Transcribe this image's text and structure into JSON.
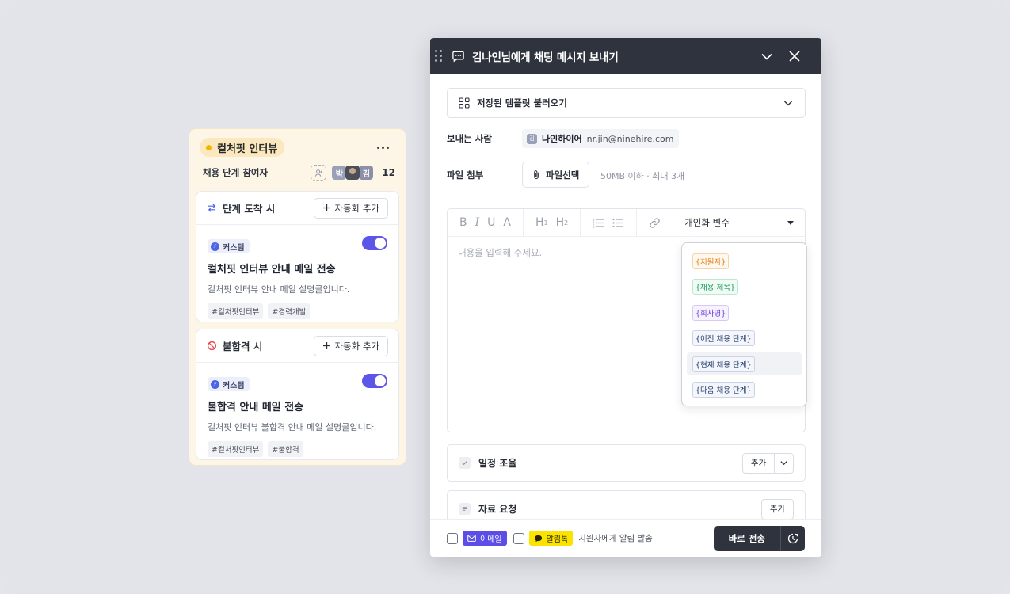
{
  "stage_card": {
    "name": "컬처핏 인터뷰",
    "participants_label": "채용 단계 참여자",
    "avatars": [
      "박",
      "",
      "김"
    ],
    "participant_count": "12",
    "sections": [
      {
        "title": "단계 도착 시",
        "add_button": "자동화 추가",
        "badge": "커스텀",
        "rule_title": "컬처핏 인터뷰 안내 메일 전송",
        "rule_desc": "컬처핏 인터뷰 안내 메일 설명글입니다.",
        "tags": [
          "#컬처핏인터뷰",
          "#경력개발"
        ],
        "enabled": true
      },
      {
        "title": "불합격 시",
        "add_button": "자동화 추가",
        "badge": "커스텀",
        "rule_title": "불합격 안내 메일 전송",
        "rule_desc": "컬처핏 인터뷰 불합격 안내 메일 설명글입니다.",
        "tags": [
          "#컬처핏인터뷰",
          "#불합격"
        ],
        "enabled": true
      }
    ]
  },
  "modal": {
    "title": "김나인님에게 채팅 메시지 보내기",
    "template_select": "저장된 템플릿 불러오기",
    "sender_label": "보내는 사람",
    "sender_initial": "김",
    "sender_name": "나인하이어",
    "sender_email": "nr.jin@ninehire.com",
    "file_label": "파일 첨부",
    "file_button": "파일선택",
    "file_hint": "50MB 이하 · 최대 3개",
    "toolbar": {
      "bold": "B",
      "italic": "I",
      "underline": "U",
      "color": "A",
      "h1": "H",
      "h1_sub": "1",
      "h2": "H",
      "h2_sub": "2",
      "variable_select": "개인화 변수"
    },
    "editor_placeholder": "내용을 입력해 주세요.",
    "variables": [
      {
        "label": "{지원자}",
        "color": "orange"
      },
      {
        "label": "{채용 제목}",
        "color": "green"
      },
      {
        "label": "{회사명}",
        "color": "purple"
      },
      {
        "label": "{이전 채용 단계}",
        "color": "navy"
      },
      {
        "label": "{현재 채용 단계}",
        "color": "navy"
      },
      {
        "label": "{다음 채용 단계}",
        "color": "navy"
      }
    ],
    "blocks": [
      {
        "title": "일정 조율",
        "button": "추가"
      },
      {
        "title": "자료 요청",
        "button": "추가"
      }
    ],
    "footer": {
      "email_label": "이메일",
      "talk_label": "알림톡",
      "notify_text": "지원자에게 알림 발송",
      "send_button": "바로 전송"
    }
  },
  "colors": {
    "accent": "#5b55e8",
    "dark_header": "#2f333d",
    "stage_bg": "#fdf6e7",
    "stage_dot": "#f5b400",
    "kakao_yellow": "#fbe300"
  }
}
